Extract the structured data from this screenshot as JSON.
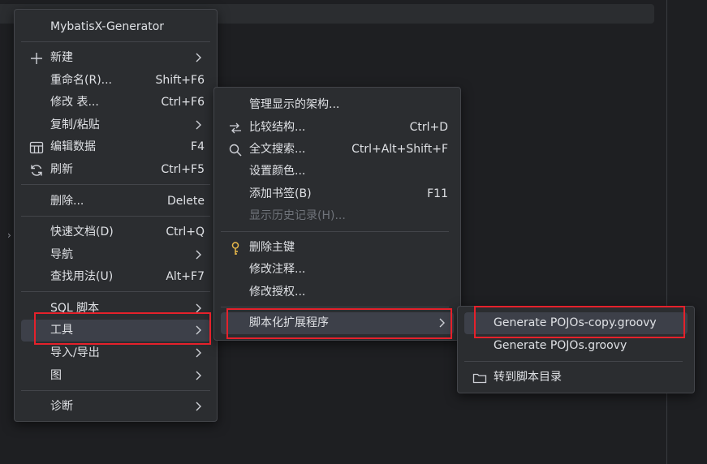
{
  "menu1": {
    "header": "MybatisX-Generator",
    "items": [
      {
        "label": "新建",
        "shortcut": "",
        "icon": "plus-icon"
      },
      {
        "label": "重命名(R)...",
        "shortcut": "Shift+F6"
      },
      {
        "label": "修改 表...",
        "shortcut": "Ctrl+F6"
      },
      {
        "label": "复制/粘贴",
        "shortcut": ""
      },
      {
        "label": "编辑数据",
        "shortcut": "F4",
        "icon": "table-icon"
      },
      {
        "label": "刷新",
        "shortcut": "Ctrl+F5",
        "icon": "refresh-icon"
      },
      {
        "label": "删除...",
        "shortcut": "Delete"
      },
      {
        "label": "快速文档(D)",
        "shortcut": "Ctrl+Q"
      },
      {
        "label": "导航",
        "shortcut": ""
      },
      {
        "label": "查找用法(U)",
        "shortcut": "Alt+F7"
      },
      {
        "label": "SQL 脚本",
        "shortcut": ""
      },
      {
        "label": "工具",
        "shortcut": ""
      },
      {
        "label": "导入/导出",
        "shortcut": ""
      },
      {
        "label": "图",
        "shortcut": ""
      },
      {
        "label": "诊断",
        "shortcut": ""
      }
    ]
  },
  "menu2": {
    "items": [
      {
        "label": "管理显示的架构...",
        "shortcut": ""
      },
      {
        "label": "比较结构...",
        "shortcut": "Ctrl+D",
        "icon": "compare-icon"
      },
      {
        "label": "全文搜索...",
        "shortcut": "Ctrl+Alt+Shift+F",
        "icon": "search-icon"
      },
      {
        "label": "设置颜色...",
        "shortcut": ""
      },
      {
        "label": "添加书签(B)",
        "shortcut": "F11"
      },
      {
        "label": "显示历史记录(H)...",
        "shortcut": ""
      },
      {
        "label": "删除主键",
        "shortcut": "",
        "icon": "key-icon"
      },
      {
        "label": "修改注释...",
        "shortcut": ""
      },
      {
        "label": "修改授权...",
        "shortcut": ""
      },
      {
        "label": "脚本化扩展程序",
        "shortcut": ""
      }
    ]
  },
  "menu3": {
    "items": [
      {
        "label": "Generate POJOs-copy.groovy"
      },
      {
        "label": "Generate POJOs.groovy"
      },
      {
        "label": "转到脚本目录",
        "icon": "folder-icon"
      }
    ]
  },
  "colors": {
    "menu_bg": "#2b2d30",
    "selected_bg": "#3d4049",
    "highlight_box": "#e5212b",
    "page_bg": "#1e1f22"
  }
}
